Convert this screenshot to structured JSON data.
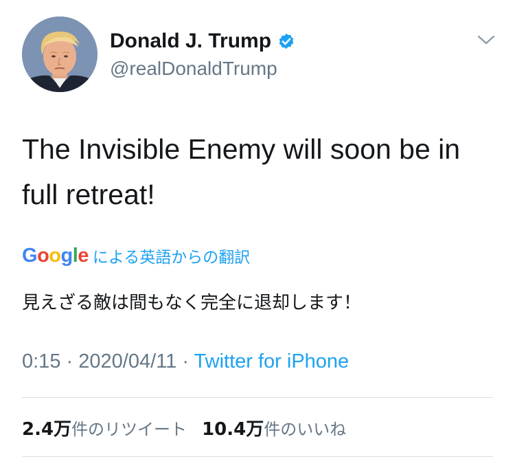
{
  "author": {
    "display_name": "Donald J. Trump",
    "handle": "@realDonaldTrump",
    "verified": true,
    "verified_icon": "verified-badge-icon",
    "avatar": "profile-photo"
  },
  "menu_icon": "chevron-down-icon",
  "tweet": {
    "text": "The Invisible Enemy will soon be in full retreat!"
  },
  "translation": {
    "provider_logo": "Google",
    "label": "による英語からの翻訳",
    "text": "見えざる敵は間もなく完全に退却します！"
  },
  "meta": {
    "time": "0:15",
    "separator": "·",
    "date": "2020/04/11",
    "source": "Twitter for iPhone"
  },
  "stats": {
    "retweets": {
      "count": "2.4万",
      "label": "件のリツイート"
    },
    "likes": {
      "count": "10.4万",
      "label": "件のいいね"
    }
  },
  "colors": {
    "link_blue": "#1da1f2",
    "secondary_text": "#657786",
    "primary_text": "#14171a",
    "divider": "#d9dfe4",
    "google_blue": "#4285f4",
    "google_red": "#ea4335",
    "google_yellow": "#fbbc05",
    "google_green": "#34a853"
  }
}
